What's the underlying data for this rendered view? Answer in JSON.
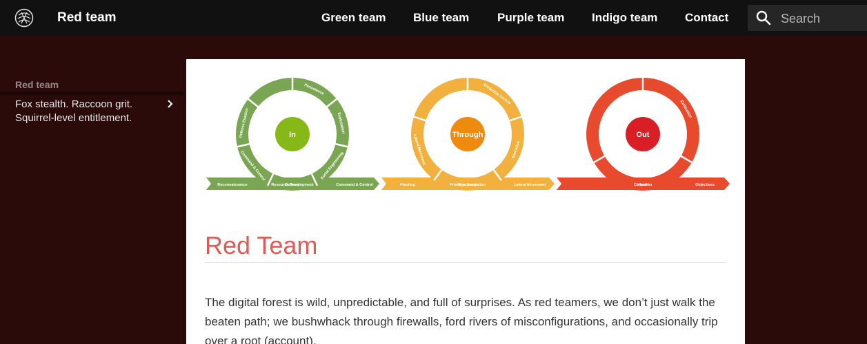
{
  "header": {
    "site_title": "Red team",
    "nav": [
      "Green team",
      "Blue team",
      "Purple team",
      "Indigo team",
      "Contact"
    ],
    "search_placeholder": "Search"
  },
  "sidebar": {
    "title": "Red team",
    "item": "Fox stealth. Raccoon grit. Squirrel-level entitlement."
  },
  "diagram": {
    "cycles": [
      {
        "center": "In",
        "color": "#7aa654",
        "center_color": "#86b818",
        "ring_labels": [
          "Persistence",
          "Exploitation",
          "Social Engineering",
          "Delivery",
          "Command & Control",
          "Defense Evasion"
        ],
        "arrow_labels": [
          "Reconnaissance",
          "Resource Development",
          "Command & Control"
        ]
      },
      {
        "center": "Through",
        "color": "#f2b03f",
        "center_color": "#ee8a0d",
        "ring_labels": [
          "Credential Access",
          "Execution",
          "Privilege Escalation",
          "Lateral Movement"
        ],
        "arrow_labels": [
          "Pivoting",
          "Discovery",
          "Lateral Movement"
        ]
      },
      {
        "center": "Out",
        "color": "#e84a2e",
        "center_color": "#d91e26",
        "ring_labels": [
          "Exfiltration",
          "Impact"
        ],
        "arrow_labels": [
          "Collection",
          "Objectives"
        ]
      }
    ]
  },
  "content": {
    "title": "Red Team",
    "paragraph": "The digital forest is wild, unpredictable, and full of surprises. As red teamers, we don’t just walk the beaten path; we bushwhack through firewalls, ford rivers of misconfigurations, and occasionally trip over a root (account)."
  }
}
